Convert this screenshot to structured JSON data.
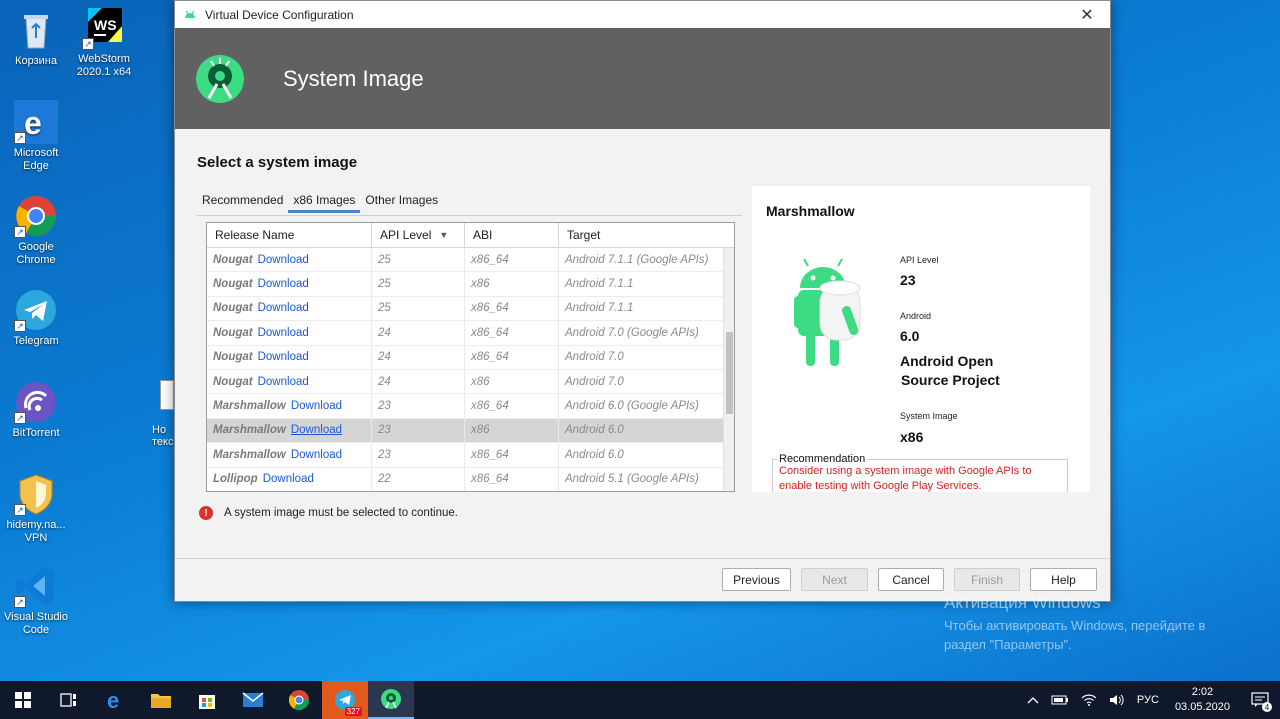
{
  "desktop": {
    "icons": [
      {
        "label": "Корзина"
      },
      {
        "label": "WebStorm 2020.1 x64",
        "ws": "WS"
      },
      {
        "label": "Microsoft Edge"
      },
      {
        "label": "Google Chrome"
      },
      {
        "label": "Telegram"
      },
      {
        "label": "BitTorrent"
      },
      {
        "label": "hidemy.na... VPN"
      },
      {
        "label": "Visual Studio Code"
      }
    ],
    "partial_file_label": "Но текс"
  },
  "dialog": {
    "window_title": "Virtual Device Configuration",
    "close_glyph": "✕",
    "banner_title": "System Image",
    "section_title": "Select a system image",
    "tabs": [
      {
        "label": "Recommended"
      },
      {
        "label": "x86 Images"
      },
      {
        "label": "Other Images"
      }
    ],
    "table": {
      "headers": [
        "Release Name",
        "API Level",
        "ABI",
        "Target"
      ],
      "sort_glyph": "▼",
      "rows": [
        {
          "name": "Nougat",
          "action": "Download",
          "api": "25",
          "abi": "x86_64",
          "target": "Android 7.1.1 (Google APIs)"
        },
        {
          "name": "Nougat",
          "action": "Download",
          "api": "25",
          "abi": "x86",
          "target": "Android 7.1.1"
        },
        {
          "name": "Nougat",
          "action": "Download",
          "api": "25",
          "abi": "x86_64",
          "target": "Android 7.1.1"
        },
        {
          "name": "Nougat",
          "action": "Download",
          "api": "24",
          "abi": "x86_64",
          "target": "Android 7.0 (Google APIs)"
        },
        {
          "name": "Nougat",
          "action": "Download",
          "api": "24",
          "abi": "x86_64",
          "target": "Android 7.0"
        },
        {
          "name": "Nougat",
          "action": "Download",
          "api": "24",
          "abi": "x86",
          "target": "Android 7.0"
        },
        {
          "name": "Marshmallow",
          "action": "Download",
          "api": "23",
          "abi": "x86_64",
          "target": "Android 6.0 (Google APIs)"
        },
        {
          "name": "Marshmallow",
          "action": "Download",
          "api": "23",
          "abi": "x86",
          "target": "Android 6.0"
        },
        {
          "name": "Marshmallow",
          "action": "Download",
          "api": "23",
          "abi": "x86_64",
          "target": "Android 6.0"
        },
        {
          "name": "Lollipop",
          "action": "Download",
          "api": "22",
          "abi": "x86_64",
          "target": "Android 5.1 (Google APIs)"
        }
      ]
    },
    "error_glyph": "!",
    "error_text": "A system image must be selected to continue.",
    "detail": {
      "name": "Marshmallow",
      "api_label": "API Level",
      "api_value": "23",
      "android_label": "Android",
      "android_value": "6.0",
      "vendor_line1": "Android Open",
      "vendor_line2": "Source Project",
      "image_label": "System Image",
      "image_value": "x86",
      "recommendation_title": "Recommendation",
      "recommendation_text": "Consider using a system image with Google APIs to enable testing with Google Play Services."
    },
    "buttons": {
      "previous": "Previous",
      "next": "Next",
      "cancel": "Cancel",
      "finish": "Finish",
      "help": "Help"
    }
  },
  "watermark": {
    "line1": "Активация Windows",
    "line2": "Чтобы активировать Windows, перейдите в раздел \"Параметры\"."
  },
  "taskbar": {
    "telegram_badge": "327",
    "language": "РУС",
    "time": "2:02",
    "date": "03.05.2020",
    "notification_count": "4"
  },
  "colors": {
    "accent": "#4a86c8",
    "link": "#1d58d6",
    "error": "#d9312e",
    "banner": "#616161",
    "android_green": "#3ddc84"
  }
}
